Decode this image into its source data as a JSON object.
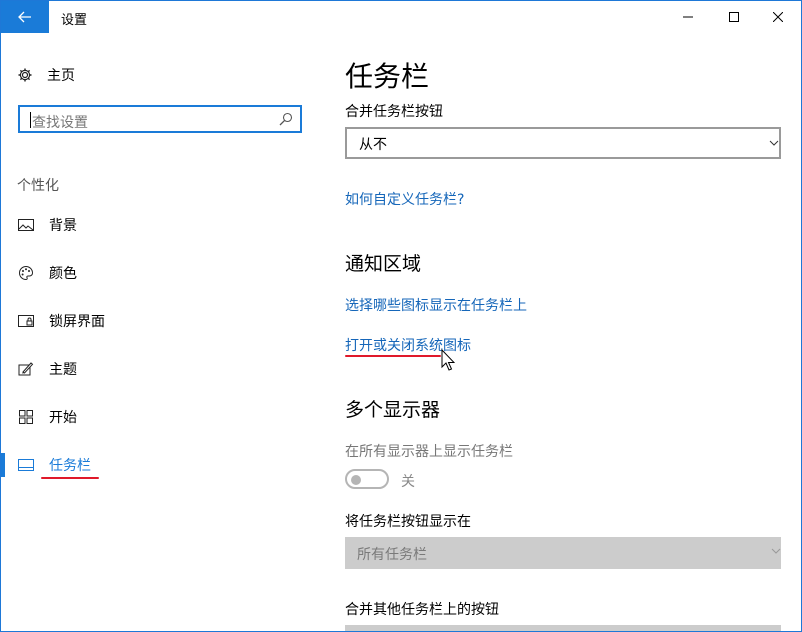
{
  "window": {
    "title": "设置"
  },
  "sidebar": {
    "home_label": "主页",
    "search_placeholder": "查找设置",
    "group_label": "个性化",
    "items": [
      {
        "label": "背景",
        "icon": "picture-icon"
      },
      {
        "label": "颜色",
        "icon": "palette-icon"
      },
      {
        "label": "锁屏界面",
        "icon": "lock-screen-icon"
      },
      {
        "label": "主题",
        "icon": "theme-brush-icon"
      },
      {
        "label": "开始",
        "icon": "start-grid-icon"
      },
      {
        "label": "任务栏",
        "icon": "taskbar-icon",
        "active": true
      }
    ]
  },
  "main": {
    "title": "任务栏",
    "combine_label": "合并任务栏按钮",
    "combine_value": "从不",
    "customize_link": "如何自定义任务栏?",
    "notification_header": "通知区域",
    "select_icons_link": "选择哪些图标显示在任务栏上",
    "system_icons_link": "打开或关闭系统图标",
    "multi_display_header": "多个显示器",
    "show_all_label": "在所有显示器上显示任务栏",
    "toggle_state": "关",
    "show_buttons_label": "将任务栏按钮显示在",
    "show_buttons_value": "所有任务栏",
    "combine_other_label": "合并其他任务栏上的按钮"
  },
  "colors": {
    "accent": "#1a7bd8",
    "link": "#1566b9",
    "annotation": "#e0192a"
  }
}
